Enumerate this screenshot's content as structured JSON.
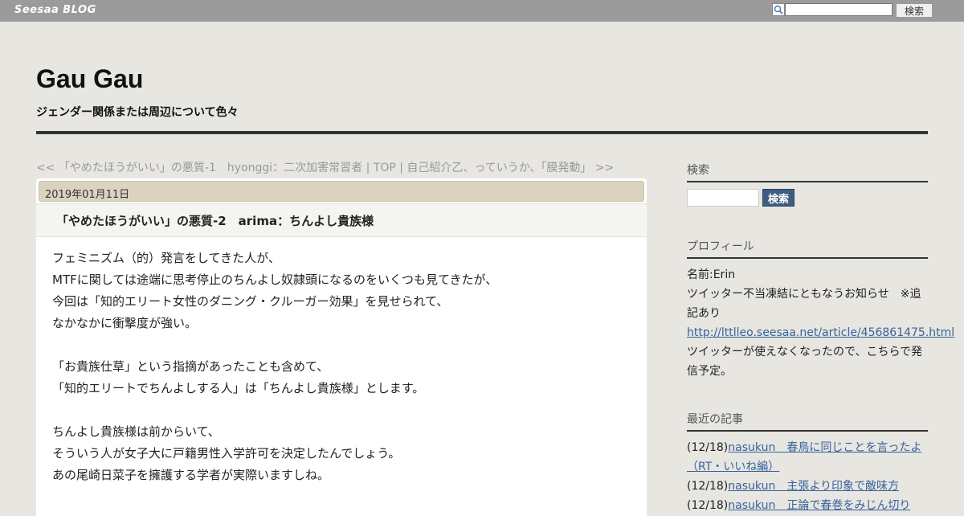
{
  "topbar": {
    "logo": "Seesaa BLOG",
    "search_button": "検索"
  },
  "header": {
    "title": "Gau Gau",
    "description": "ジェンダー関係または周辺について色々"
  },
  "pager": {
    "prev": "<< 「やめたほうがいい」の悪質-1　hyonggi：二次加害常習者",
    "sep1": " | ",
    "top": "TOP",
    "sep2": " | ",
    "next": "自己紹介乙、っていうか、「膜発動」 >>"
  },
  "article": {
    "date": "2019年01月11日",
    "title": "「やめたほうがいい」の悪質-2　arima：ちんよし貴族様",
    "paragraphs": [
      [
        "フェミニズム（的）発言をしてきた人が、",
        "MTFに関しては途端に思考停止のちんよし奴隷頭になるのをいくつも見てきたが、",
        "今回は「知的エリート女性のダニング・クルーガー効果」を見せられて、",
        "なかなかに衝撃度が強い。"
      ],
      [
        "「お貴族仕草」という指摘があったことも含めて、",
        "「知的エリートでちんよしする人」は「ちんよし貴族様」とします。"
      ],
      [
        "ちんよし貴族様は前からいて、",
        "そういう人が女子大に戸籍男性入学許可を決定したんでしょう。",
        "あの尾崎日菜子を擁護する学者が実際いますしね。"
      ]
    ]
  },
  "sidebar": {
    "search_heading": "検索",
    "search_button": "検索",
    "profile_heading": "プロフィール",
    "profile_name": "名前:Erin",
    "profile_notice": "ツイッター不当凍結にともなうお知らせ　※追記あり",
    "profile_link": "http://lttlleo.seesaa.net/article/456861475.html",
    "profile_after": "ツイッターが使えなくなったので、こちらで発信予定。",
    "recent_heading": "最近の記事",
    "recent": [
      {
        "date": "(12/18)",
        "title": "nasukun　春鳥に同じことを言ったよ（RT・いいね編）"
      },
      {
        "date": "(12/18)",
        "title": "nasukun　主張より印象で敵味方"
      },
      {
        "date": "(12/18)",
        "title": "nasukun　正論で春巻をみじん切り"
      }
    ]
  }
}
